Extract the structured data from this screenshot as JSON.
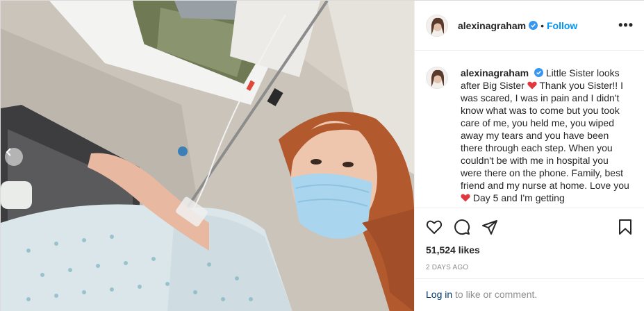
{
  "post": {
    "username": "alexinagraham",
    "follow_label": "Follow",
    "separator": "•",
    "more_label": "•••",
    "caption_parts": [
      "Little Sister looks after Big Sister",
      "Thank you Sister!! I was scared, I was in pain and I didn't know what was to come but you took care of me, you held me, you wiped away my tears and you have been there through each step. When you couldn't be with me in hospital you were there on the phone. Family, best friend and my nurse at home. Love you",
      "Day 5 and I'm getting"
    ],
    "likes": "51,524 likes",
    "date": "2 DAYS AGO",
    "login_link": "Log in",
    "login_suffix": " to like or comment."
  },
  "icons": {
    "verified": "verified-badge-icon",
    "heart_emoji": "red-heart-emoji",
    "like": "heart-outline-icon",
    "comment": "comment-bubble-icon",
    "share": "paper-plane-icon",
    "save": "bookmark-icon",
    "carousel_prev": "chevron-left-icon"
  },
  "colors": {
    "follow": "#0095f6",
    "verified": "#3897f0",
    "heart": "#ed4956",
    "muted": "#8e8e8e",
    "link": "#00376b"
  }
}
